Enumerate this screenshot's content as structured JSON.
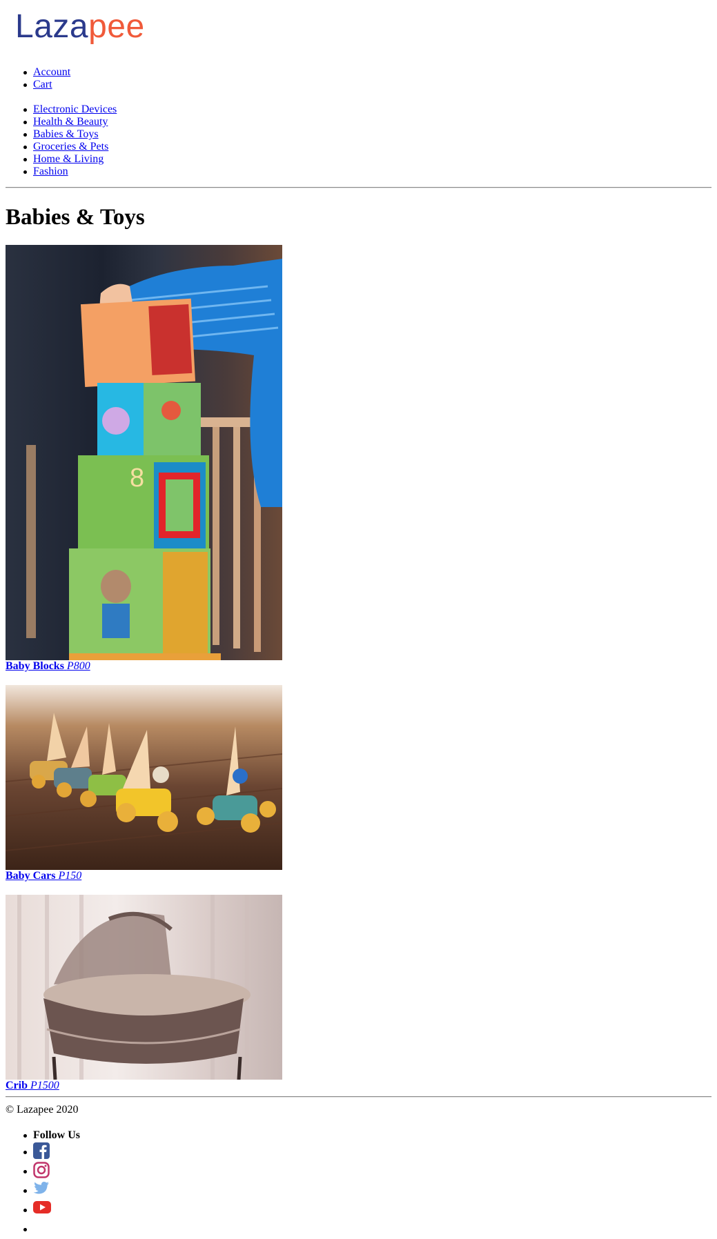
{
  "logo": {
    "part1": "Laza",
    "part2": "pee"
  },
  "account_nav": [
    "Account",
    "Cart"
  ],
  "categories": [
    "Electronic Devices",
    "Health & Beauty",
    "Babies & Toys",
    "Groceries & Pets",
    "Home & Living",
    "Fashion"
  ],
  "page_title": "Babies & Toys",
  "products": [
    {
      "name": "Baby Blocks",
      "price": "P800"
    },
    {
      "name": "Baby Cars",
      "price": "P150"
    },
    {
      "name": "Crib",
      "price": "P1500"
    }
  ],
  "footer": {
    "copyright": "© Lazapee 2020",
    "follow_label": "Follow Us",
    "social_icons": [
      "facebook-icon",
      "instagram-icon",
      "twitter-icon",
      "youtube-icon"
    ]
  },
  "colors": {
    "link": "#0000ee",
    "logo_blue": "#2b3a8c",
    "logo_orange": "#f05a3a"
  }
}
